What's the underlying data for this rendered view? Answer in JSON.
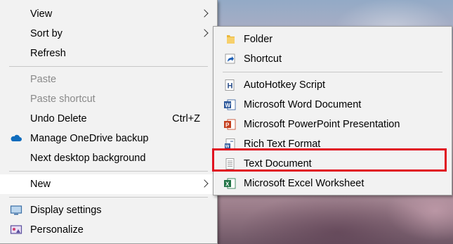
{
  "main_menu": {
    "view": "View",
    "sort_by": "Sort by",
    "refresh": "Refresh",
    "paste": "Paste",
    "paste_shortcut": "Paste shortcut",
    "undo_delete": "Undo Delete",
    "undo_delete_shortcut": "Ctrl+Z",
    "manage_onedrive": "Manage OneDrive backup",
    "next_background": "Next desktop background",
    "new": "New",
    "display_settings": "Display settings",
    "personalize": "Personalize"
  },
  "new_submenu": {
    "folder": "Folder",
    "shortcut": "Shortcut",
    "autohotkey": "AutoHotkey Script",
    "word": "Microsoft Word Document",
    "powerpoint": "Microsoft PowerPoint Presentation",
    "rtf": "Rich Text Format",
    "text": "Text Document",
    "excel": "Microsoft Excel Worksheet"
  },
  "colors": {
    "highlight_box": "#e01020",
    "menu_bg": "#f2f2f2"
  }
}
